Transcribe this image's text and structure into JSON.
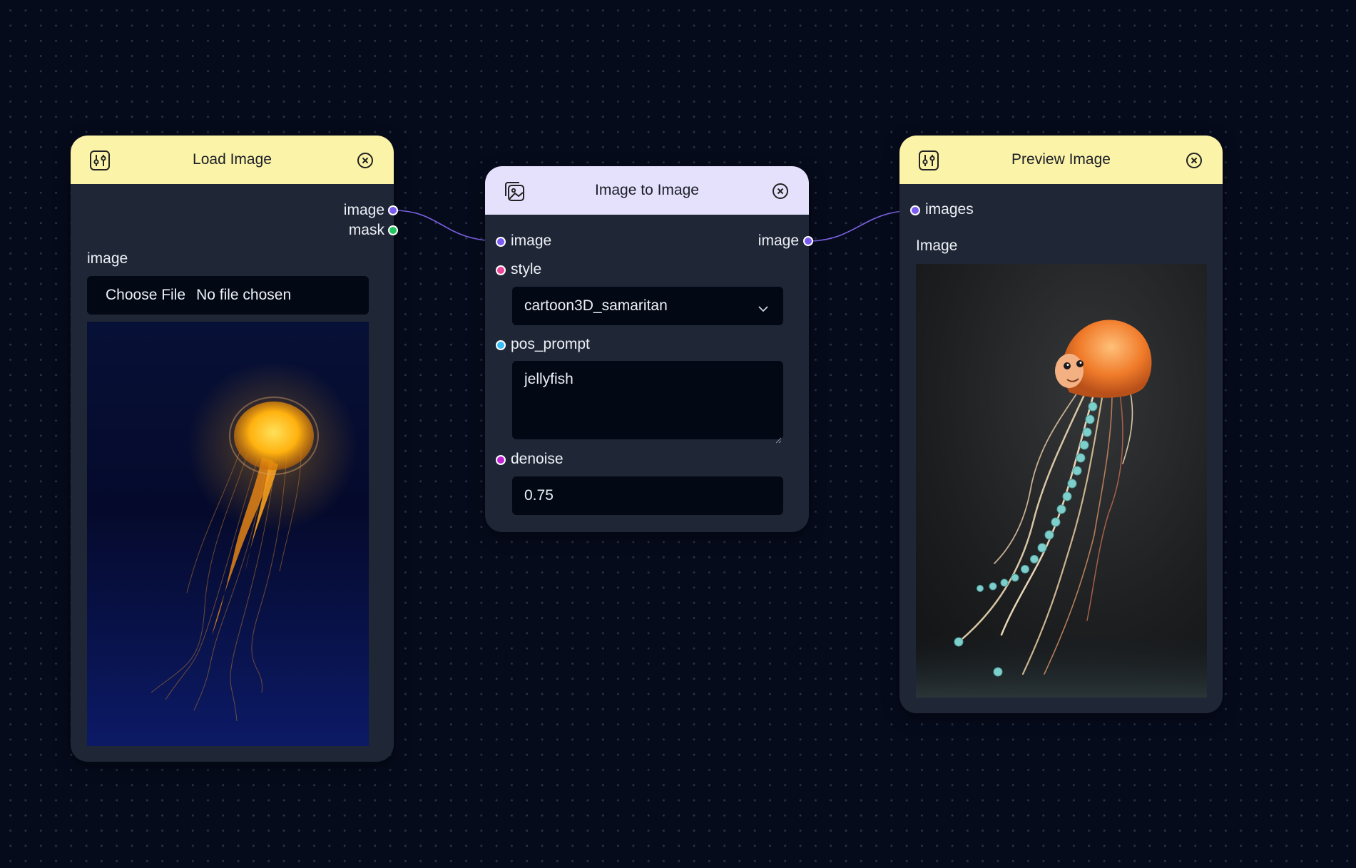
{
  "colors": {
    "canvas_bg": "#060b1c",
    "node_bg": "#1f2737",
    "header_yellow": "#fbf3a8",
    "header_purple": "#e5e1fc",
    "port_image": "#7b5cf0",
    "port_mask": "#22c55e",
    "port_style": "#ec4899",
    "port_prompt": "#38bdf8",
    "port_denoise": "#c026d3",
    "wire": "#7d63e6"
  },
  "load_image": {
    "title": "Load Image",
    "header_icon": "sliders-icon",
    "close_icon": "close-circle-icon",
    "outputs": [
      {
        "label": "image",
        "color": "#7b5cf0"
      },
      {
        "label": "mask",
        "color": "#22c55e"
      }
    ],
    "widget_label": "image",
    "choose_file_label": "Choose File",
    "no_file_label": "No file chosen",
    "preview_icon": "jellyfish-photo"
  },
  "image_to_image": {
    "title": "Image to Image",
    "header_icon": "image-gallery-icon",
    "close_icon": "close-circle-icon",
    "input_image_label": "image",
    "output_image_label": "image",
    "style_label": "style",
    "style_value": "cartoon3D_samaritan",
    "pos_prompt_label": "pos_prompt",
    "pos_prompt_value": "jellyfish",
    "denoise_label": "denoise",
    "denoise_value": "0.75"
  },
  "preview_image": {
    "title": "Preview Image",
    "header_icon": "sliders-icon",
    "close_icon": "close-circle-icon",
    "input_label": "images",
    "image_label": "Image",
    "preview_icon": "cartoon-jellyfish-render"
  }
}
